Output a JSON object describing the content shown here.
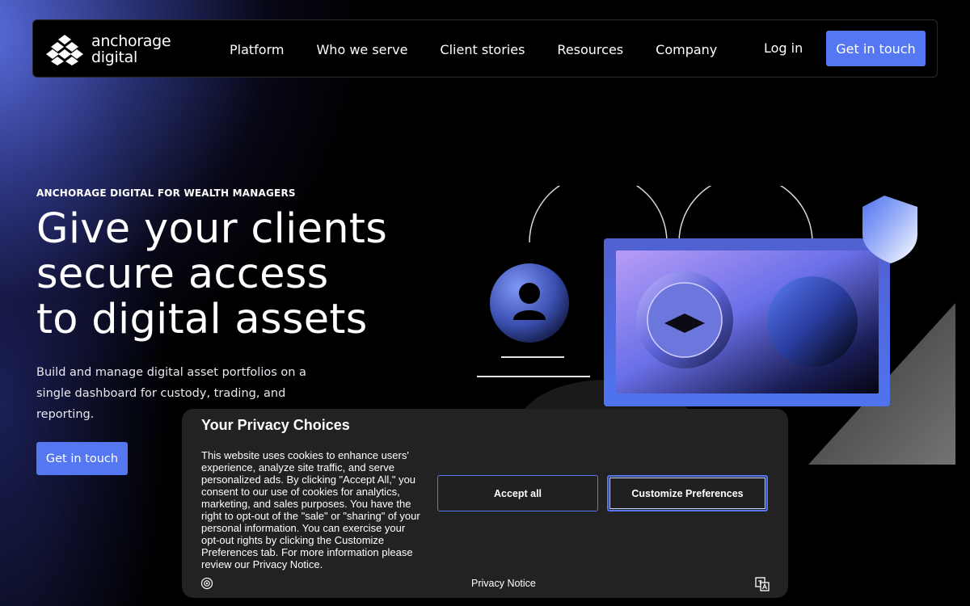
{
  "brand": {
    "name_line1": "anchorage",
    "name_line2": "digital"
  },
  "nav": {
    "links": [
      "Platform",
      "Who we serve",
      "Client stories",
      "Resources",
      "Company"
    ],
    "login": "Log in",
    "cta": "Get in touch"
  },
  "hero": {
    "eyebrow": "ANCHORAGE DIGITAL FOR WEALTH MANAGERS",
    "headline": [
      "Give your clients",
      "secure access",
      "to digital assets"
    ],
    "subtext": "Build and manage digital asset portfolios on a single dashboard for custody, trading, and reporting.",
    "cta": "Get in touch"
  },
  "cookie": {
    "title": "Your Privacy Choices",
    "body": "This website uses cookies to enhance users' experience, analyze site traffic, and serve personalized ads. By clicking \"Accept All,\" you consent to our use of cookies for analytics, marketing, and sales purposes. You have the right to opt-out of the \"sale\" or \"sharing\" of your personal information. You can exercise your opt-out rights by clicking the Customize Preferences tab. For more information please review our Privacy Notice.",
    "accept": "Accept all",
    "customize": "Customize Preferences",
    "privacy_notice": "Privacy Notice"
  },
  "colors": {
    "accent": "#5578f2",
    "background": "#000000",
    "banner": "#222222"
  },
  "icons": [
    "anchorage-logo-icon",
    "user-icon",
    "shield-icon",
    "gear-icon",
    "translate-icon"
  ]
}
